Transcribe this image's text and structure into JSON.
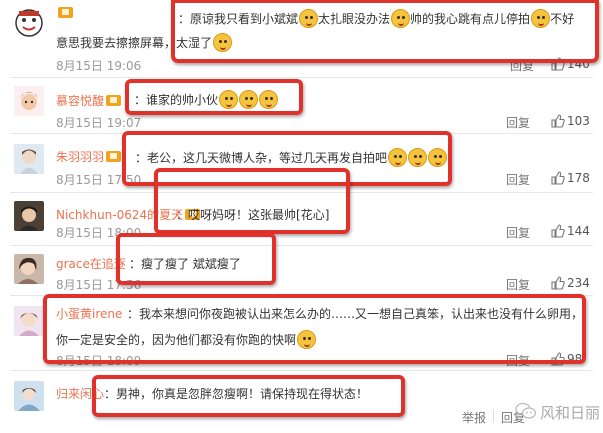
{
  "comments": [
    {
      "name": "",
      "text": "原谅我只看到小斌斌",
      "text2": "太扎眼没办法",
      "text3": "帅的我心跳有点儿停拍",
      "text4": "不好",
      "text_line2": "意思我要去擦擦屏幕，太湿了",
      "date": "8月15日 19:06",
      "reply": "回复",
      "likes": "140"
    },
    {
      "name": "慕容悦馥",
      "text": "谁家的帅小伙",
      "date": "8月15日 19:07",
      "reply": "回复",
      "likes": "103"
    },
    {
      "name": "朱羽羽羽",
      "text": "老公，这几天微博人杂，等过几天再发自拍吧",
      "date": "8月15日 17:50",
      "reply": "回复",
      "likes": "178"
    },
    {
      "name": "Nichkhun-0624的夏天",
      "text": "哎呀妈呀！这张最帅[花心]",
      "date": "8月15日 18:00",
      "reply": "回复",
      "likes": "144"
    },
    {
      "name": "grace在追逐",
      "text": "瘦了瘦了 斌斌瘦了",
      "date": "8月15日 17:56",
      "reply": "回复",
      "likes": "234"
    },
    {
      "name": "小蛋黄irene",
      "text": "我本来想问你夜跑被认出来怎么办的……又一想自己真笨，认出来也没有什么卵用，",
      "text_line2": "你一定是安全的，因为他们都没有你跑的快啊",
      "date": "8月15日 18:09",
      "reply": "回复",
      "likes": "98"
    },
    {
      "name": "归来闲心",
      "text": "男神，你真是忽胖忽瘦啊！请保持现在得状态！",
      "report": "举报",
      "reply": "回复"
    }
  ],
  "watermark": "风和日丽",
  "colors": {
    "accent": "#eb7350",
    "highlight": "#e0312a"
  }
}
